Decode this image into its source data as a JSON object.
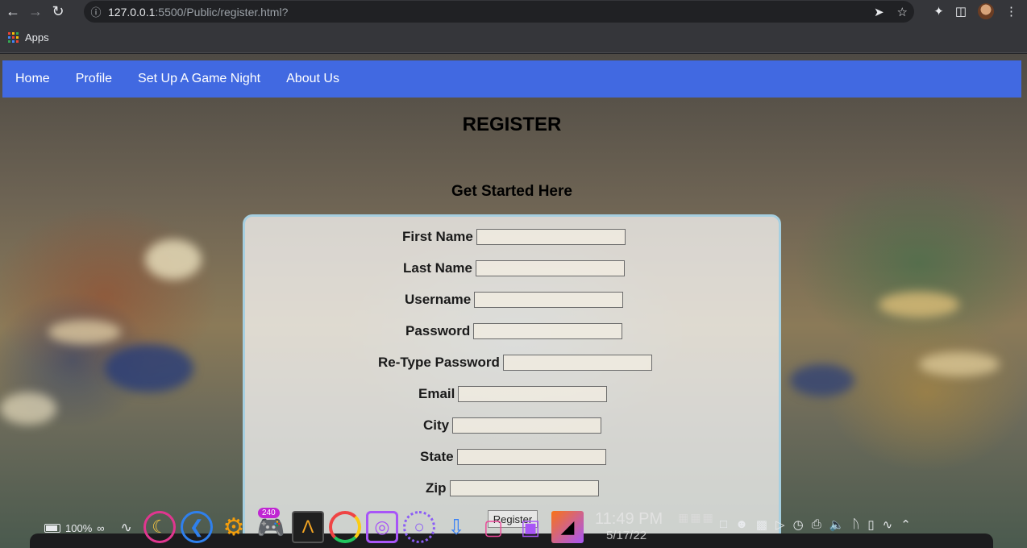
{
  "browser": {
    "url_host": "127.0.0.1",
    "url_path": ":5500/Public/register.html?",
    "bookmarks_label": "Apps"
  },
  "navbar": {
    "items": [
      {
        "label": "Home"
      },
      {
        "label": "Profile"
      },
      {
        "label": "Set Up A Game Night"
      },
      {
        "label": "About Us"
      }
    ]
  },
  "page": {
    "title": "REGISTER",
    "subtitle": "Get Started Here"
  },
  "form": {
    "fields": [
      {
        "label": "First Name",
        "value": ""
      },
      {
        "label": "Last Name",
        "value": ""
      },
      {
        "label": "Username",
        "value": ""
      },
      {
        "label": "Password",
        "value": ""
      },
      {
        "label": "Re-Type Password",
        "value": ""
      },
      {
        "label": "Email",
        "value": ""
      },
      {
        "label": "City",
        "value": ""
      },
      {
        "label": "State",
        "value": ""
      },
      {
        "label": "Zip",
        "value": ""
      }
    ],
    "submit_label": "Register"
  },
  "taskbar": {
    "battery": "100%",
    "battery_suffix": "∞",
    "badge_count": "240",
    "time": "11:49 PM",
    "date": "5/17/22"
  },
  "colors": {
    "navbar": "#4169e1",
    "card_border": "#a6cfe0"
  }
}
